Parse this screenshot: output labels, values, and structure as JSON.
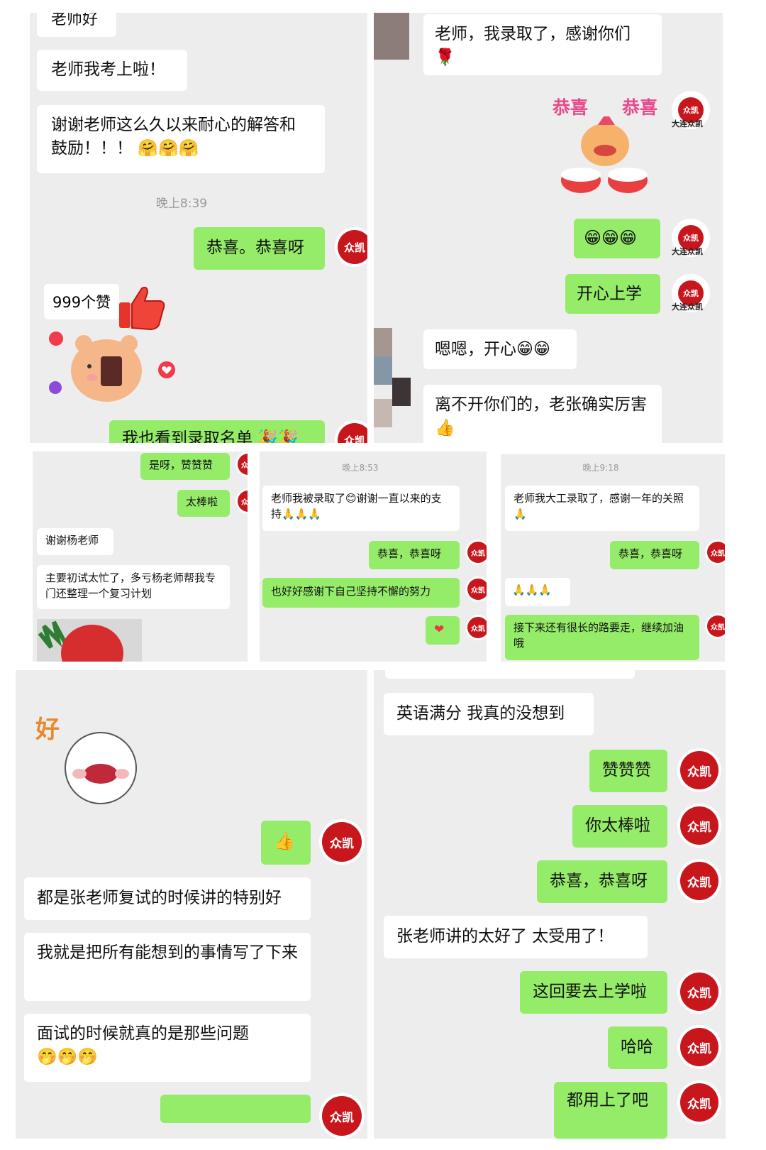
{
  "panel1": {
    "partial_top": "老师好",
    "msg1": "老师我考上啦！",
    "msg2": "谢谢老师这么久以来耐心的解答和鼓励！！！",
    "msg2_emoji": "🤗🤗🤗",
    "time": "晚上8:39",
    "reply1": "恭喜。恭喜呀",
    "like_label": "999个赞",
    "partial_bottom": "我也看到录取名单",
    "partial_bottom_emoji": "🎉🎉"
  },
  "panel2": {
    "msg1": "老师，我录取了，感谢你们",
    "msg1_emoji": "🌹",
    "sticker_text_left": "恭喜",
    "sticker_text_right": "恭喜",
    "reply_emoji": "😁😁😁",
    "reply2": "开心上学",
    "msg2": "嗯嗯，开心",
    "msg2_emoji": "😁😁",
    "msg3": "离不开你们的，老张确实厉害",
    "msg3_emoji": "👍",
    "brand_tag": "大连众凯"
  },
  "panel3": {
    "reply1": "是呀，赞赞赞",
    "reply2": "太棒啦",
    "msg1": "谢谢杨老师",
    "msg2": "主要初试太忙了，多亏杨老师帮我专门还整理一个复习计划"
  },
  "panel4": {
    "time": "晚上8:53",
    "msg1": "老师我被录取了😊谢谢一直以来的支持",
    "msg1_emoji": "🙏🙏🙏",
    "reply1": "恭喜，恭喜呀",
    "reply2": "也好好感谢下自己坚持不懈的努力",
    "reply3": "❤"
  },
  "panel5": {
    "time": "晚上9:18",
    "msg1": "老师我大工录取了，感谢一年的关照",
    "msg1_emoji": "🙏",
    "reply1": "恭喜，恭喜呀",
    "msg2_emoji": "🙏🙏🙏",
    "reply2": "接下来还有很长的路要走，继续加油哦"
  },
  "panel6": {
    "sticker_text": "好",
    "reply_emoji": "👍",
    "msg1": "都是张老师复试的时候讲的特别好",
    "msg2": "我就是把所有能想到的事情写了下来",
    "msg3": "面试的时候就真的是那些问题",
    "msg3_emoji": "🤭🤭🤭"
  },
  "panel7": {
    "msg1": "英语满分 我真的没想到",
    "reply1": "赞赞赞",
    "reply2": "你太棒啦",
    "reply3": "恭喜，恭喜呀",
    "msg2": "张老师讲的太好了 太受用了！",
    "reply4": "这回要去上学啦",
    "reply5": "哈哈",
    "partial_bottom": "都用上了吧"
  },
  "avatar_text": "众凯",
  "colors": {
    "green_bubble": "#95ec69",
    "white_bubble": "#ffffff",
    "chat_bg": "#ededed",
    "brand_red": "#c8161d"
  }
}
